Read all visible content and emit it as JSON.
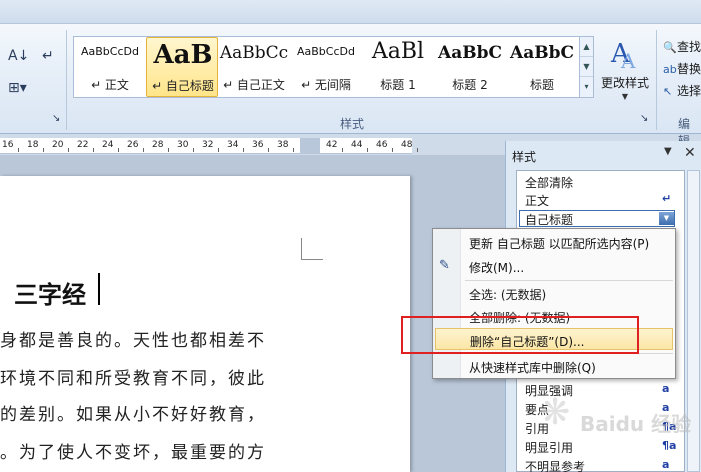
{
  "ribbon": {
    "styles": [
      {
        "preview": "AaBbCcDd",
        "name": "↵ 正文",
        "size": 11
      },
      {
        "preview": "AaB",
        "name": "↵ 自己标题",
        "size": 26,
        "bold": true,
        "selected": true
      },
      {
        "preview": "AaBbCc",
        "name": "↵ 自己正文",
        "size": 17
      },
      {
        "preview": "AaBbCcDd",
        "name": "↵ 无间隔",
        "size": 11
      },
      {
        "preview": "AaBl",
        "name": "标题 1",
        "size": 22
      },
      {
        "preview": "AaBbC",
        "name": "标题 2",
        "size": 17,
        "bold": true
      },
      {
        "preview": "AaBbC",
        "name": "标题",
        "size": 17,
        "bold": true
      }
    ],
    "change_styles_label": "更改样式",
    "styles_group_label": "样式",
    "edit_group_label": "编辑",
    "edit_items": [
      "查找",
      "替换",
      "选择"
    ]
  },
  "ruler": {
    "numbers_left": [
      "16",
      "18",
      "20",
      "22",
      "24",
      "26",
      "28",
      "30",
      "32",
      "34",
      "36",
      "38"
    ],
    "numbers_right": [
      "42",
      "44",
      "46",
      "48"
    ]
  },
  "document": {
    "heading": "三字经",
    "lines": [
      "身都是善良的。天性也都相差不",
      "环境不同和所受教育不同，彼此",
      "的差别。如果从小不好好教育，",
      "。为了使人不变坏，最重要的方"
    ]
  },
  "styles_pane": {
    "title": "样式",
    "items": [
      "全部清除",
      "正文",
      "自己标题"
    ],
    "items_bottom": [
      "明显强调",
      "要点",
      "引用",
      "明显引用",
      "不明显参考"
    ],
    "symbols_bottom": [
      "a",
      "a",
      "¶a",
      "¶a",
      "a"
    ],
    "paragraph_symbol": "↵"
  },
  "context_menu": {
    "items": [
      {
        "label": "更新 自己标题 以匹配所选内容(P)",
        "icon": ""
      },
      {
        "label": "修改(M)...",
        "icon": "modify-icon"
      },
      {
        "label": "全选: (无数据)",
        "icon": ""
      },
      {
        "label": "全部删除: (无数据)",
        "icon": ""
      },
      {
        "label": "删除“自己标题”(D)...",
        "icon": "",
        "highlighted": true
      },
      {
        "label": "从快速样式库中删除(Q)",
        "icon": ""
      }
    ]
  },
  "watermark": {
    "text": "Baidu 经验"
  }
}
